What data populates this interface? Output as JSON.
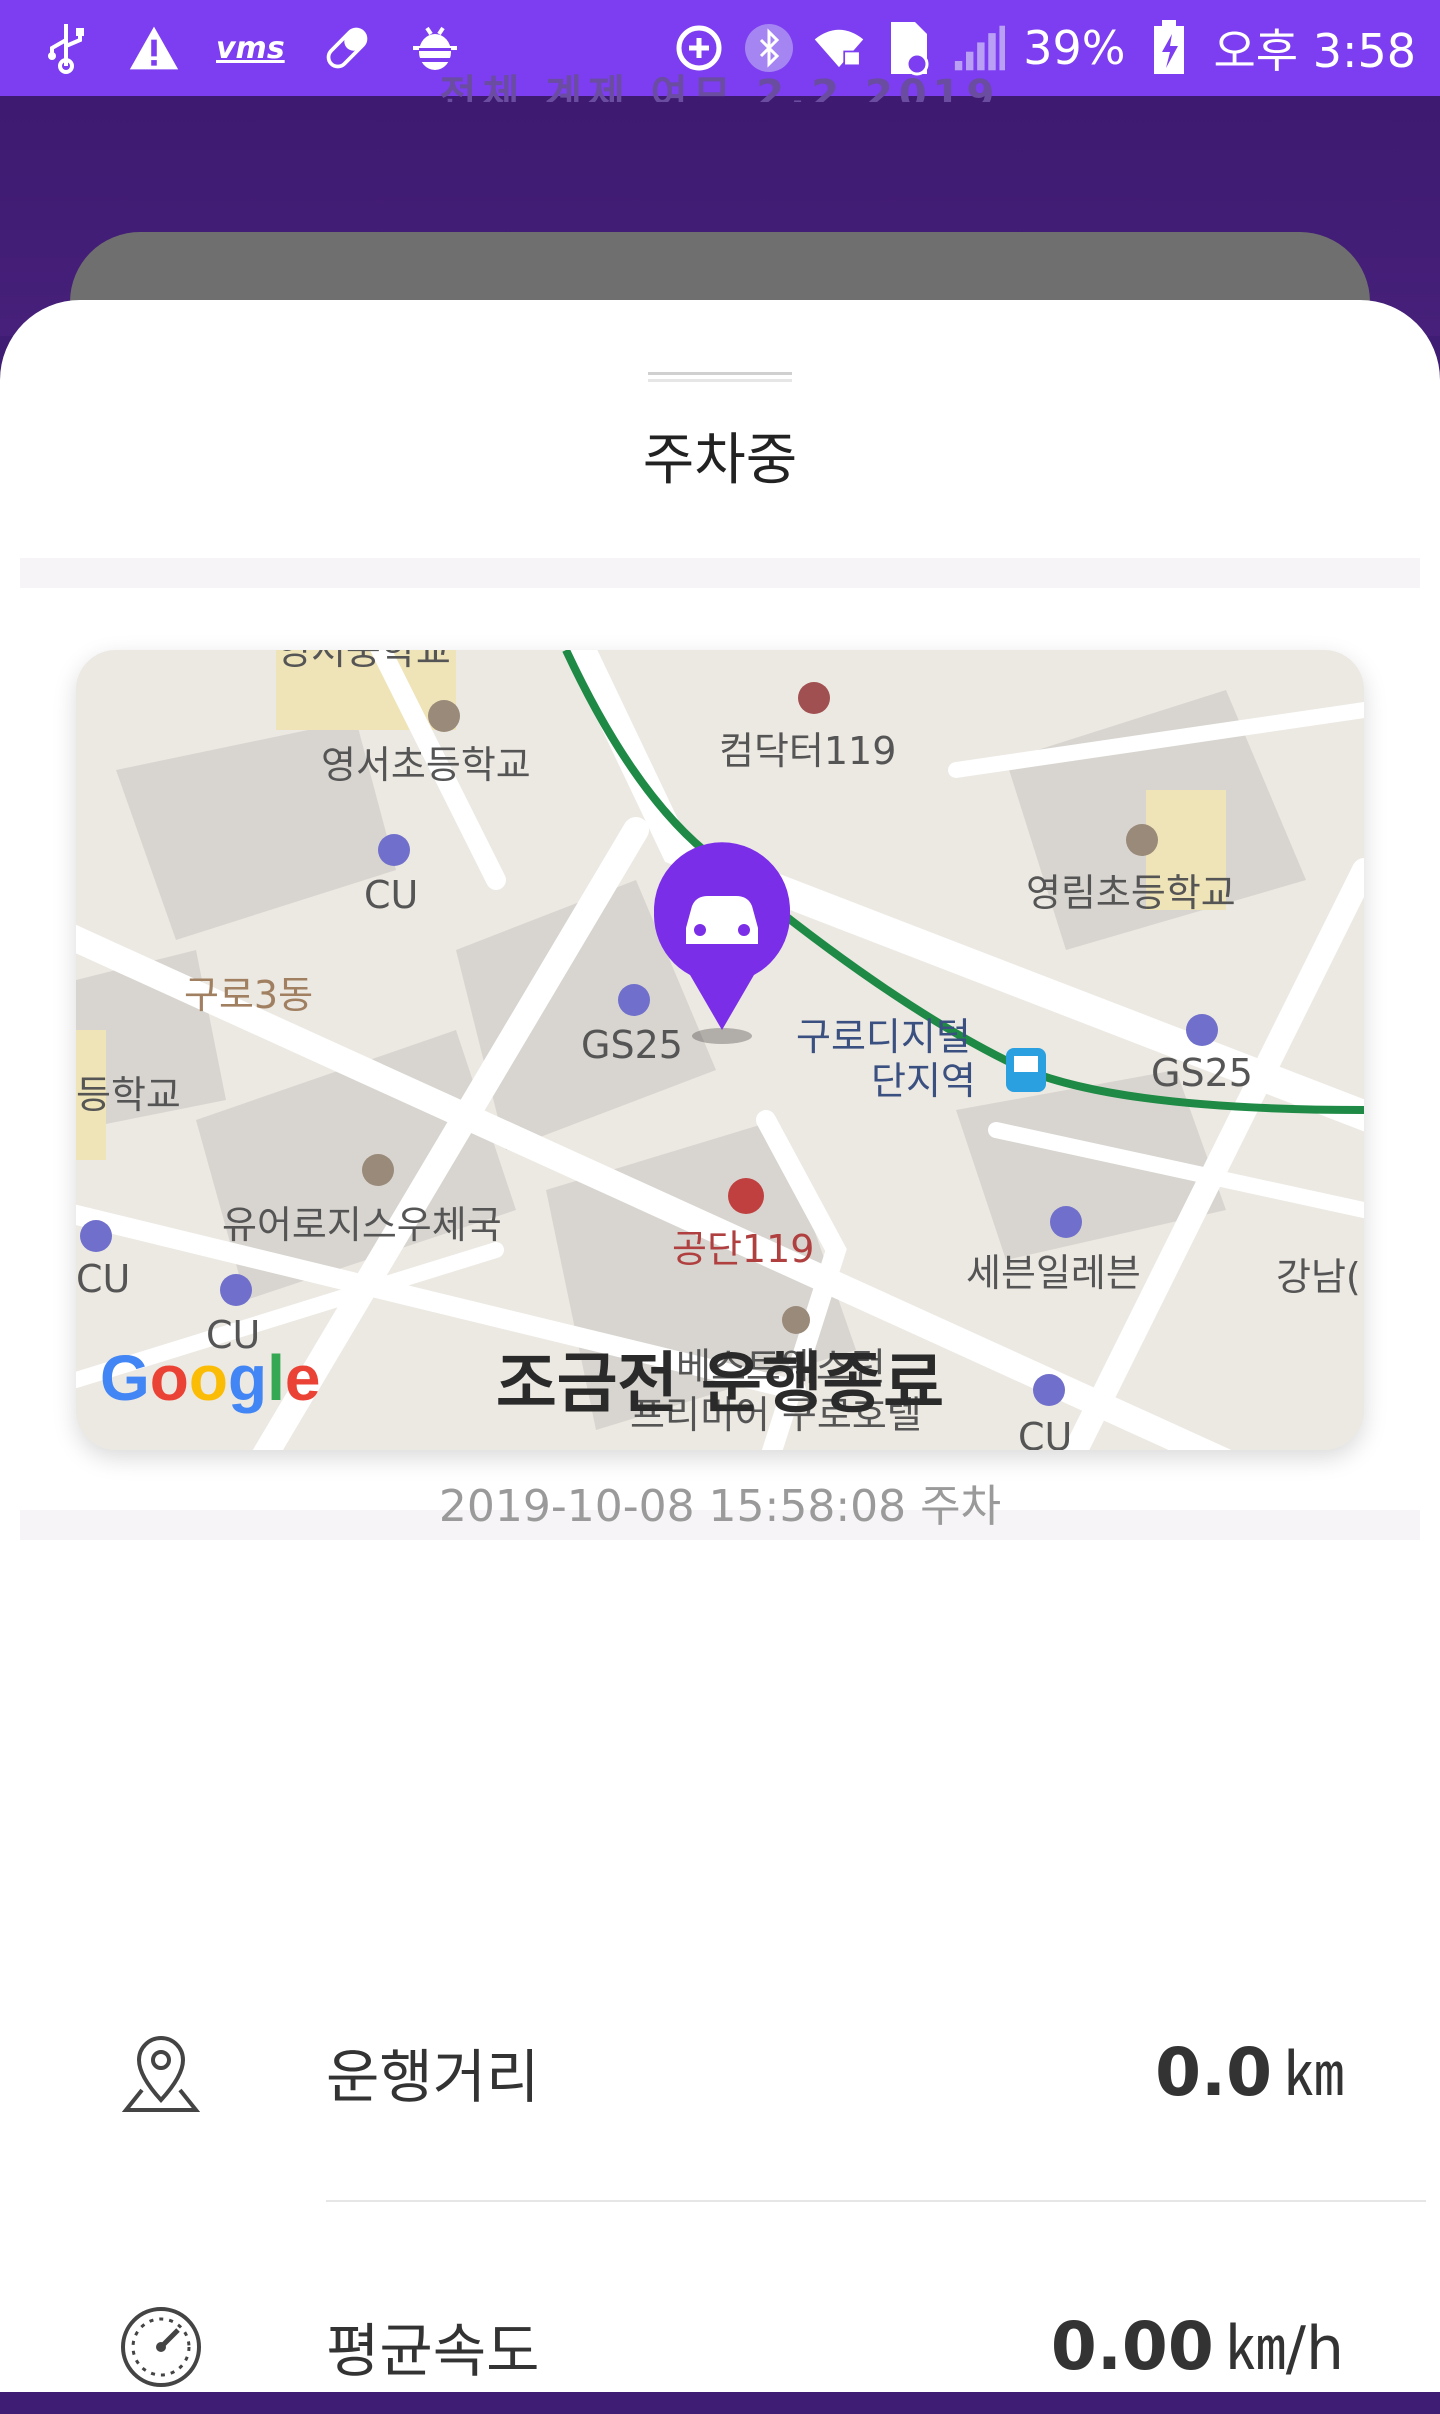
{
  "status_bar": {
    "vms_label": "vms",
    "battery": "39%",
    "time": "오후 3:58"
  },
  "header": {
    "ghost_text": "전체 계제 여므 2.2 2019"
  },
  "sheet": {
    "title": "주차중"
  },
  "map": {
    "labels": {
      "school1": "영서초등학교",
      "cu1": "CU",
      "gs25_1": "GS25",
      "guro3": "구로3동",
      "school_left": "등학교",
      "post": "유어로지스우체국",
      "cu2": "CU",
      "cu3": "CU",
      "computer": "컴닥터119",
      "school2": "영림초등학교",
      "station1": "구로디지털",
      "station2": "단지역",
      "gs25_2": "GS25",
      "gongdan": "공단119",
      "seven": "세븐일레븐",
      "gangnam": "강남(",
      "hotel1": "베스트웨스턴",
      "hotel2": "프리미어 구로호텔",
      "cu4": "CU",
      "top_cut": "영서중학교",
      "google": "Google"
    },
    "colors": {
      "marker": "#7b2ee8",
      "route": "#1e8a45"
    }
  },
  "drive": {
    "title": "조금전 운행종료",
    "parked_at": "2019-10-08 15:58:08 주차"
  },
  "stats": [
    {
      "label": "운행거리",
      "value": "0.0",
      "unit": "㎞",
      "icon": "map-pin-icon"
    },
    {
      "label": "평균속도",
      "value": "0.00",
      "unit": "㎞/h",
      "icon": "speedometer-icon"
    }
  ]
}
